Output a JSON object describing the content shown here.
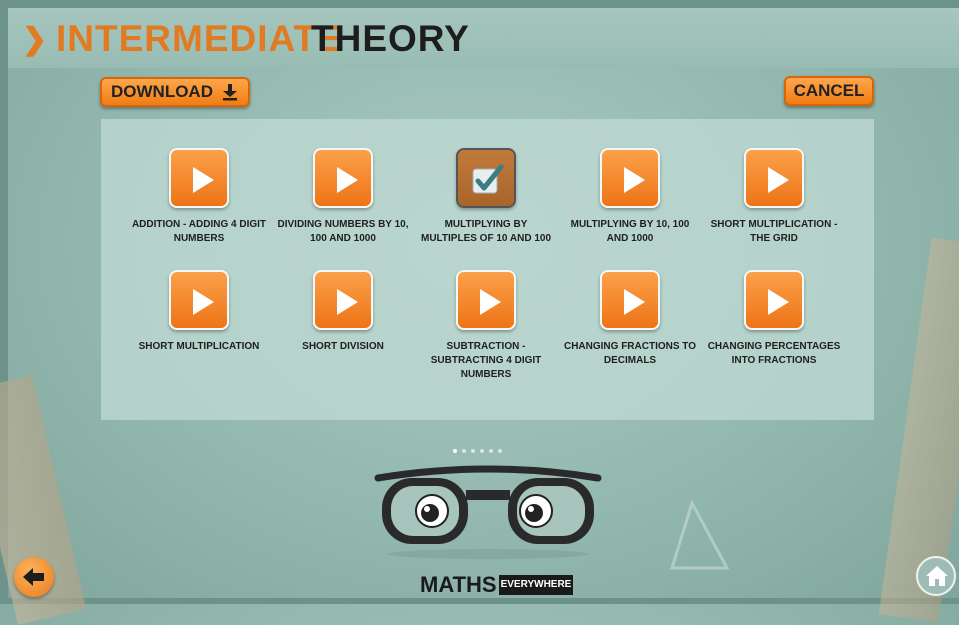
{
  "header": {
    "chevron": "❯",
    "title_part1": "INTERMEDIATE",
    "title_part2": "THEORY"
  },
  "toolbar": {
    "download_label": "DOWNLOAD",
    "download_icon": "download-arrow-icon",
    "cancel_label": "CANCEL"
  },
  "tiles": [
    {
      "label": "ADDITION - ADDING 4 DIGIT NUMBERS",
      "state": "play"
    },
    {
      "label": "DIVIDING NUMBERS BY 10, 100 AND 1000",
      "state": "play"
    },
    {
      "label": "MULTIPLYING BY MULTIPLES OF 10 AND 100",
      "state": "checked"
    },
    {
      "label": "MULTIPLYING BY 10, 100 AND 1000",
      "state": "play"
    },
    {
      "label": "SHORT MULTIPLICATION - THE GRID",
      "state": "play"
    },
    {
      "label": "SHORT MULTIPLICATION",
      "state": "play"
    },
    {
      "label": "SHORT DIVISION",
      "state": "play"
    },
    {
      "label": "SUBTRACTION - SUBTRACTING 4 DIGIT NUMBERS",
      "state": "play"
    },
    {
      "label": "CHANGING FRACTIONS TO DECIMALS",
      "state": "play"
    },
    {
      "label": "CHANGING PERCENTAGES INTO FRACTIONS",
      "state": "play"
    }
  ],
  "pagination": {
    "active_index": 0
  },
  "logo": {
    "part1": "MATHS",
    "part2": "EVERYWHERE"
  },
  "colors": {
    "accent": "#f07d14",
    "background": "#93b8af",
    "text": "#1f1f1f"
  },
  "icons": {
    "back": "back-arrow-icon",
    "home": "home-icon"
  }
}
